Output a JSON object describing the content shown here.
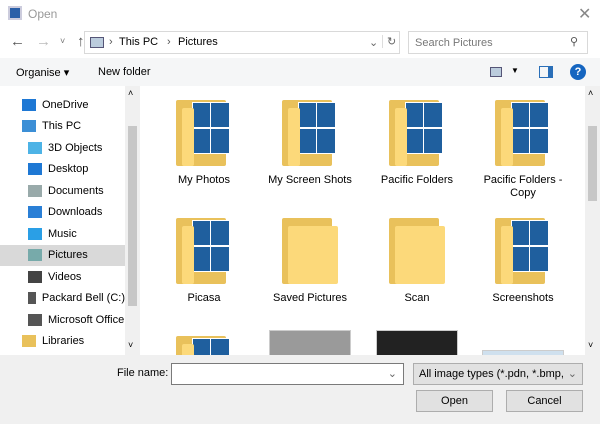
{
  "window": {
    "title": "Open",
    "close_icon": "close-icon"
  },
  "nav": {
    "path": [
      "This PC",
      "Pictures"
    ],
    "search_placeholder": "Search Pictures"
  },
  "toolbar": {
    "organise": "Organise ▾",
    "new_folder": "New folder"
  },
  "sidebar": {
    "items": [
      {
        "label": "OneDrive",
        "icon": "cloud-icon",
        "color": "#1e78d4",
        "indent": 0
      },
      {
        "label": "This PC",
        "icon": "computer-icon",
        "color": "#3c8fd6",
        "indent": 0
      },
      {
        "label": "3D Objects",
        "icon": "cube-icon",
        "color": "#4db3e6",
        "indent": 1
      },
      {
        "label": "Desktop",
        "icon": "desktop-icon",
        "color": "#1e78d4",
        "indent": 1
      },
      {
        "label": "Documents",
        "icon": "document-icon",
        "color": "#9aa",
        "indent": 1
      },
      {
        "label": "Downloads",
        "icon": "download-icon",
        "color": "#2a7fd6",
        "indent": 1
      },
      {
        "label": "Music",
        "icon": "music-icon",
        "color": "#2a9fe6",
        "indent": 1
      },
      {
        "label": "Pictures",
        "icon": "pictures-icon",
        "color": "#7aa",
        "indent": 1,
        "selected": true
      },
      {
        "label": "Videos",
        "icon": "videos-icon",
        "color": "#444",
        "indent": 1
      },
      {
        "label": "Packard Bell (C:)",
        "icon": "drive-icon",
        "color": "#555",
        "indent": 1
      },
      {
        "label": "Microsoft Office",
        "icon": "drive-icon",
        "color": "#555",
        "indent": 1
      },
      {
        "label": "Libraries",
        "icon": "folder-icon",
        "color": "#e9c15b",
        "indent": 0
      }
    ]
  },
  "items": [
    {
      "label": "My Photos",
      "type": "folder",
      "photos": true
    },
    {
      "label": "My Screen Shots",
      "type": "folder",
      "photos": true
    },
    {
      "label": "Pacific Folders",
      "type": "folder",
      "photos": true
    },
    {
      "label": "Pacific Folders - Copy",
      "type": "folder",
      "photos": true
    },
    {
      "label": "Picasa",
      "type": "folder",
      "photos": true
    },
    {
      "label": "Saved Pictures",
      "type": "folder",
      "photos": false
    },
    {
      "label": "Scan",
      "type": "folder",
      "photos": false
    },
    {
      "label": "Screenshots",
      "type": "folder",
      "photos": true
    },
    {
      "label": "",
      "type": "folder",
      "photos": true
    },
    {
      "label": "",
      "type": "image",
      "color": "#9a9a9a"
    },
    {
      "label": "",
      "type": "image",
      "color": "#222"
    },
    {
      "label": "",
      "type": "image",
      "color": "#cfe0ee"
    }
  ],
  "footer": {
    "file_name_label": "File name:",
    "file_name_value": "",
    "file_type": "All image types (*.pdn, *.bmp, *",
    "open": "Open",
    "cancel": "Cancel"
  }
}
